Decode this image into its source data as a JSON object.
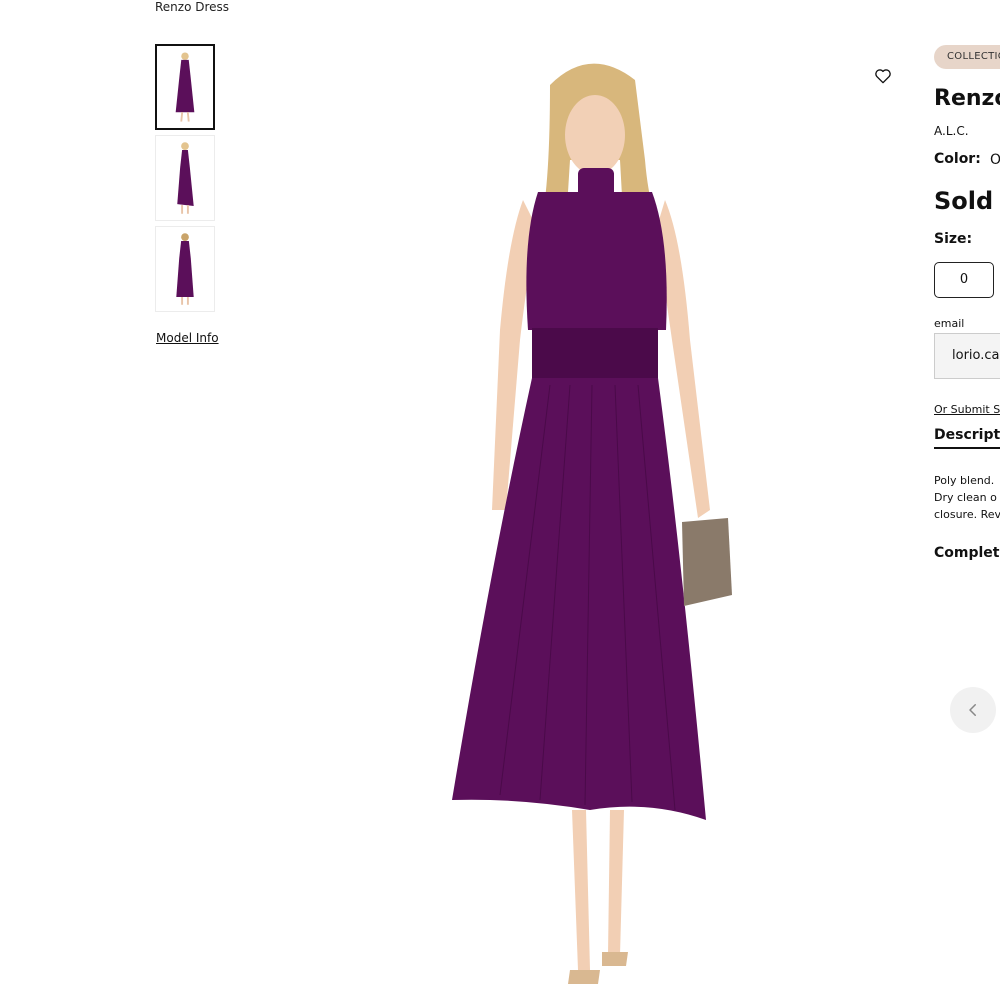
{
  "breadcrumb": {
    "current": "Renzo Dress"
  },
  "gallery": {
    "model_info_label": "Model Info"
  },
  "product": {
    "collection_badge": "COLLECTION",
    "title": "Renzo",
    "brand": "A.L.C.",
    "color_label": "Color:",
    "color_value": "O",
    "status": "Sold C",
    "size_label": "Size:",
    "sizes": [
      "0"
    ],
    "email_label": "email",
    "email_value": "lorio.ca",
    "submit_label": "Or Submit S",
    "description_tab": "Descript",
    "description_lines": [
      "Poly blend.",
      "Dry clean o",
      "closure. Rev"
    ],
    "complete_label": "Complet"
  },
  "icons": {
    "favorite": "heart-outline-icon",
    "carousel_prev": "chevron-left-icon"
  },
  "colors": {
    "dress": "#5b0f5a",
    "badge": "#e7d5c9",
    "carousel_btn": "#f1f1f1"
  }
}
